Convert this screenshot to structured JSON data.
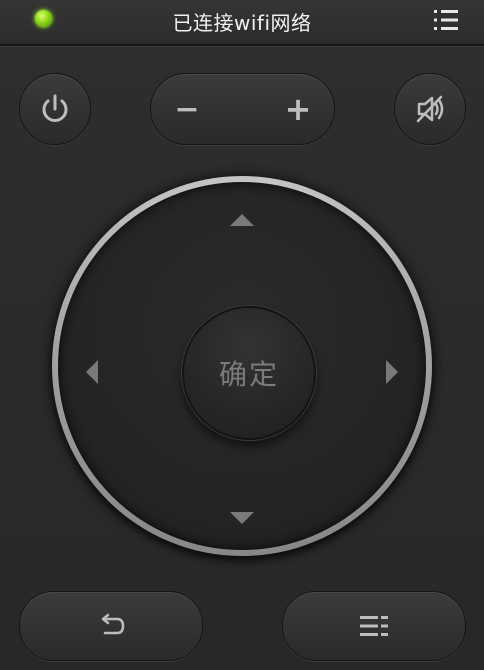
{
  "status": {
    "connected": true,
    "led_color": "#7ed321"
  },
  "header": {
    "title": "已连接wifi网络",
    "menu_icon": "list-menu-icon"
  },
  "controls": {
    "power_icon": "power-icon",
    "volume": {
      "minus": "−",
      "plus": "+"
    },
    "mute_icon": "speaker-mute-icon"
  },
  "dpad": {
    "ok_label": "确定",
    "up_icon": "triangle-up-icon",
    "down_icon": "triangle-down-icon",
    "left_icon": "triangle-left-icon",
    "right_icon": "triangle-right-icon"
  },
  "bottom": {
    "back_icon": "back-arrow-icon",
    "menu_icon": "menu-lines-icon"
  },
  "colors": {
    "background": "#2b2b2b",
    "icon": "#bdbdbd",
    "ring": "#d9d9d9"
  }
}
